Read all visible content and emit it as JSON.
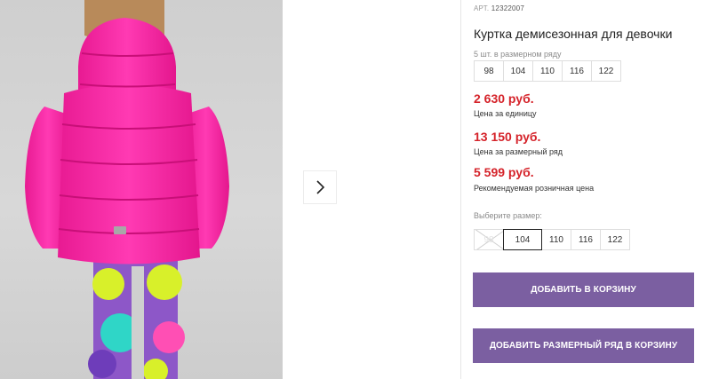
{
  "gallery": {
    "image_alt": "Куртка демисезонная для девочки",
    "next_icon": "chevron-right-icon"
  },
  "product": {
    "article_label": "АРТ.",
    "article_number": "12322007",
    "title": "Куртка демисезонная для девочки",
    "set_note": "5 шт. в размерном ряду",
    "set_sizes": [
      "98",
      "104",
      "110",
      "116",
      "122"
    ]
  },
  "prices": {
    "unit_price": "2 630 руб.",
    "unit_label": "Цена за единицу",
    "set_price": "13 150 руб.",
    "set_label": "Цена за размерный ряд",
    "retail_price": "5 599 руб.",
    "retail_label": "Рекомендуемая розничная цена"
  },
  "size_picker": {
    "label": "Выберите размер:",
    "options": [
      {
        "value": "98",
        "state": "disabled"
      },
      {
        "value": "104",
        "state": "selected"
      },
      {
        "value": "110",
        "state": "available"
      },
      {
        "value": "116",
        "state": "available"
      },
      {
        "value": "122",
        "state": "available"
      }
    ]
  },
  "actions": {
    "add_to_cart": "ДОБАВИТЬ В КОРЗИНУ",
    "add_set_to_cart": "ДОБАВИТЬ РАЗМЕРНЫЙ РЯД В КОРЗИНУ"
  },
  "colors": {
    "price_red": "#d5232a",
    "button_purple": "#7b5fa1",
    "jacket_pink": "#ff2aa8"
  }
}
